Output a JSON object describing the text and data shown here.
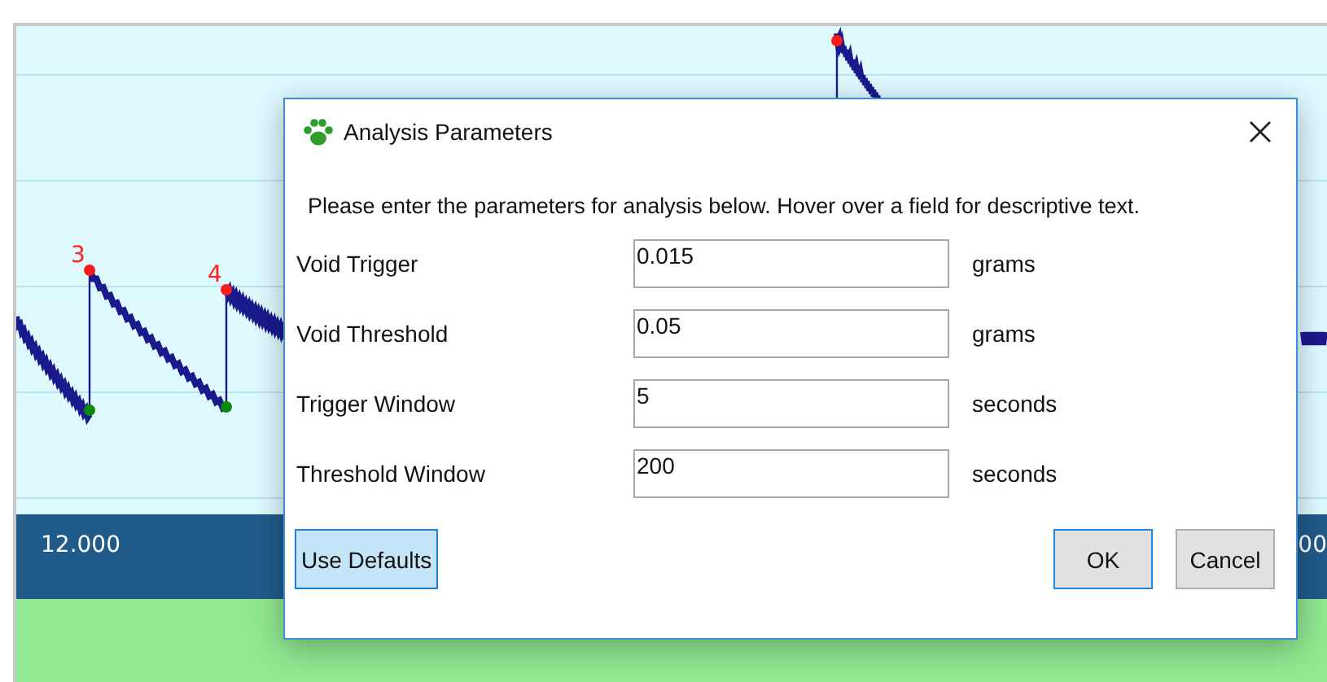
{
  "chart": {
    "peak_labels": [
      "3",
      "4"
    ],
    "axis_labels": [
      "12.000",
      "00"
    ]
  },
  "dialog": {
    "title": "Analysis Parameters",
    "instructions": "Please enter the parameters for analysis below. Hover over a field for descriptive text.",
    "fields": [
      {
        "label": "Void Trigger",
        "value": "0.015",
        "unit": "grams"
      },
      {
        "label": "Void Threshold",
        "value": "0.05",
        "unit": "grams"
      },
      {
        "label": "Trigger Window",
        "value": "5",
        "unit": "seconds"
      },
      {
        "label": "Threshold Window",
        "value": "200",
        "unit": "seconds"
      }
    ],
    "buttons": [
      {
        "label": "Use Defaults",
        "kind": "left",
        "selected": true
      },
      {
        "label": "OK",
        "kind": "right",
        "selected": false,
        "default": true
      },
      {
        "label": "Cancel",
        "kind": "right",
        "selected": false,
        "default": false
      }
    ]
  }
}
